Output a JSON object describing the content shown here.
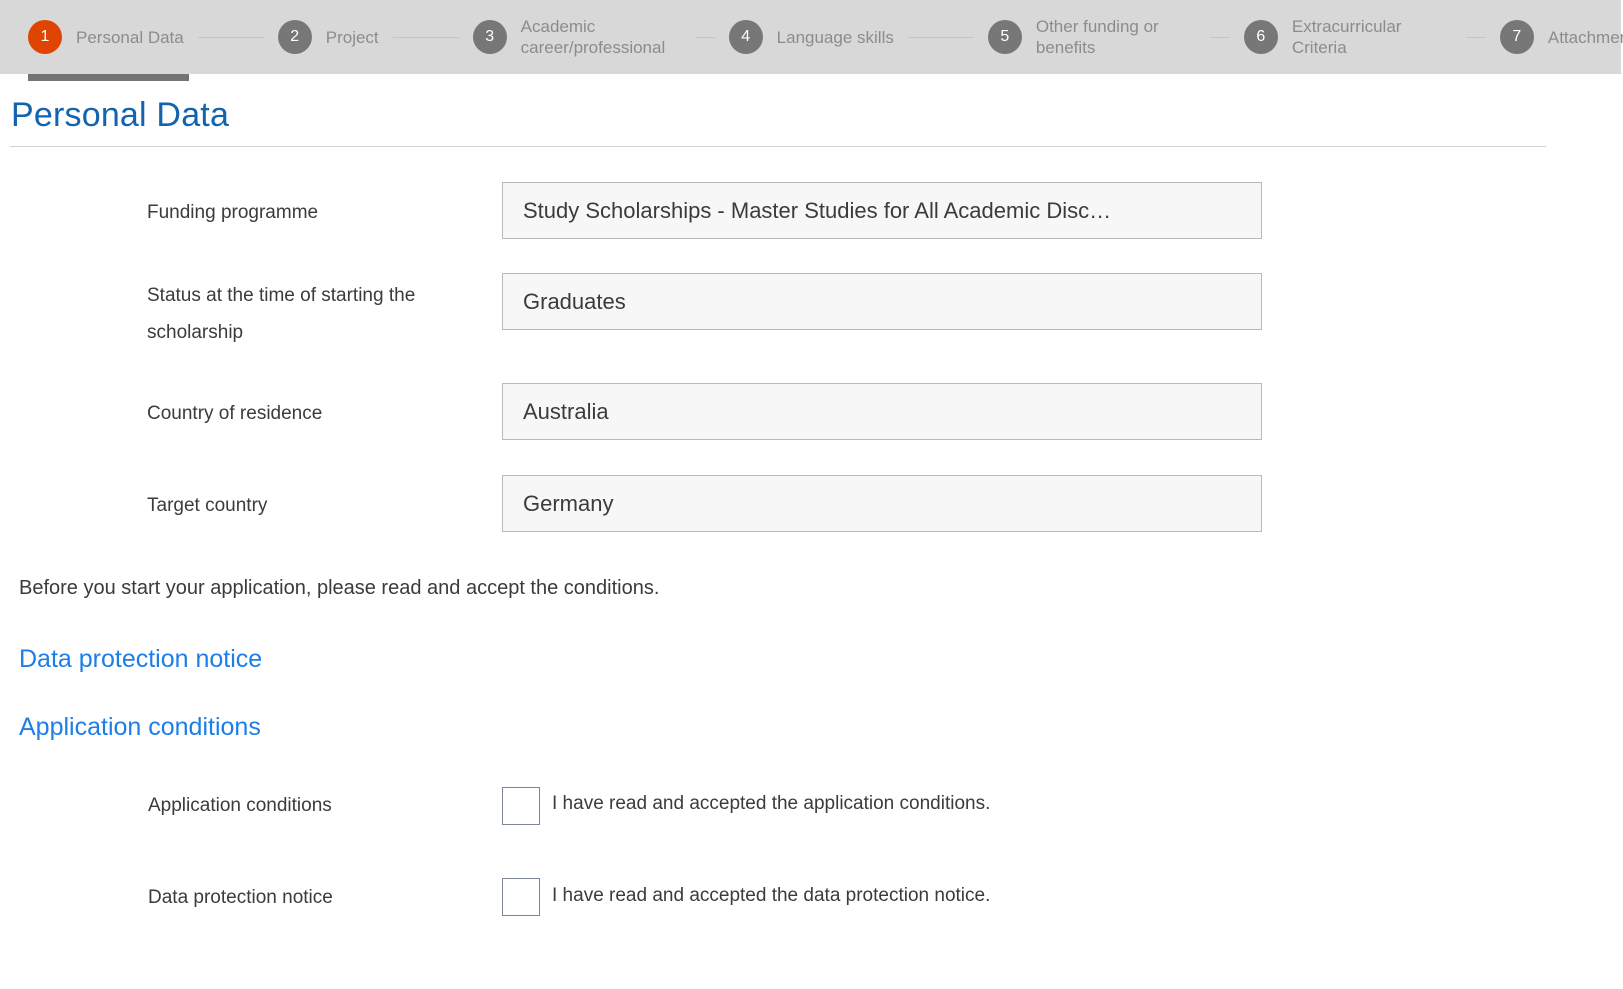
{
  "stepper": {
    "steps": [
      {
        "number": "1",
        "label": "Personal Data",
        "active": true
      },
      {
        "number": "2",
        "label": "Project",
        "active": false
      },
      {
        "number": "3",
        "label": "Academic career/professional",
        "active": false
      },
      {
        "number": "4",
        "label": "Language skills",
        "active": false
      },
      {
        "number": "5",
        "label": "Other funding or benefits",
        "active": false
      },
      {
        "number": "6",
        "label": "Extracurricular Criteria",
        "active": false
      },
      {
        "number": "7",
        "label": "Attachments",
        "active": false
      }
    ],
    "active_color": "#e04403",
    "inactive_color": "#777777",
    "bar_background": "#d8d8d8",
    "underline_color": "#737373"
  },
  "page": {
    "title": "Personal Data",
    "title_color": "#1263b0"
  },
  "form": {
    "fields": [
      {
        "label": "Funding programme",
        "value": "Study Scholarships - Master Studies for All Academic Disc…"
      },
      {
        "label": "Status at the time of starting the scholarship",
        "value": "Graduates"
      },
      {
        "label": "Country of residence",
        "value": "Australia"
      },
      {
        "label": "Target country",
        "value": "Germany"
      }
    ]
  },
  "conditions": {
    "intro": "Before you start your application, please read and accept the conditions.",
    "links": [
      {
        "text": "Data protection notice"
      },
      {
        "text": "Application conditions"
      }
    ],
    "link_color": "#1c7ee8",
    "checkboxes": [
      {
        "label": "Application conditions",
        "text": "I have read and accepted the application conditions.",
        "checked": false
      },
      {
        "label": "Data protection notice",
        "text": "I have read and accepted the data protection notice.",
        "checked": false
      }
    ]
  }
}
